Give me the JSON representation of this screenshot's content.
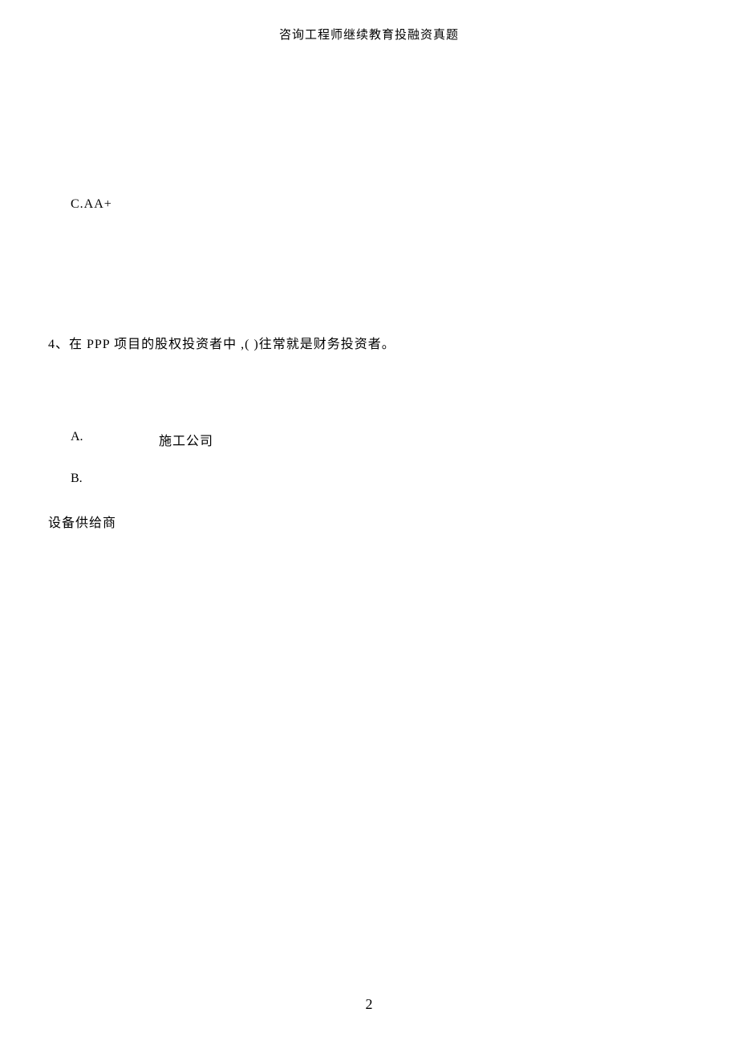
{
  "header": {
    "title": "咨询工程师继续教育投融资真题"
  },
  "content": {
    "option_c": "C.AA+",
    "question_4": "4、在 PPP 项目的股权投资者中 ,(   )往常就是财务投资者。",
    "option_a_label": "A.",
    "option_a_text": "施工公司",
    "option_b_label": "B.",
    "option_b_text": "设备供给商"
  },
  "footer": {
    "page_number": "2"
  }
}
